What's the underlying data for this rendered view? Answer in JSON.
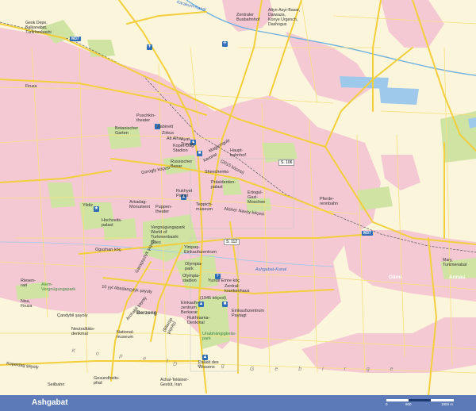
{
  "labels": {
    "karakum": "Karakum-Kanal",
    "bus": "Zentraler\nBusbahnhof",
    "altyn": "Altyn-Asyr-Basar,\nDarwaza,\nKonye Urgench,\nDashogus",
    "geok": "Geok Depe,\nBalkanabat,\nTurkmenbashi",
    "m37a": "M37",
    "m37b": "M37",
    "firuza": "Firuza",
    "puschkin": "Puschkin-\ntheater",
    "botan": "Botanischer\nGarten",
    "kabinet": "Kabinett",
    "zirkus": "Zirkus",
    "alta": "Alt Alha",
    "kopet": "Kopet-Dag-\nStadion",
    "ayat": "Ayat-\nTravel",
    "rbasar": "Russischer\nBasar",
    "hbahn": "Haupt-\nbahnhof",
    "s106": "S. 106",
    "gorogly": "Gorogly köçesi",
    "shevchenko": "Shevchenko",
    "magtymguly": "Magtymguly şayoly",
    "kemine": "Kemine",
    "atamyrat": "(2015 köçesi)",
    "pras": "Präsidenten-\npalast",
    "ertogrul": "Ertogul-\nGazi-\nMoschee",
    "rukhyet": "Rukhyet\nPalast",
    "atabaev": "Ataba",
    "yildiz": "Yildiz",
    "arkadag": "Arkadag-\nMonument",
    "puppen": "Puppen-\ntheater",
    "teppich": "Teppich-\nmuseum",
    "alisher": "Alisher Navoy köçesi",
    "hochzeit": "Hochzeits-\npalast",
    "pferde": "Pferde-\nrennbahn",
    "vergn": "Vergnügungspark\nWorld of\nTurkmenbashi\nTales",
    "s112": "S. 112",
    "yimpas": "Yimpaş-\nEinkaufszentrum",
    "oguzhan": "Oguzhan köç.",
    "garashsyzlyk": "Garaşsyzlyk şayoly",
    "olympia": "Olympia-\nstadion",
    "olympiac": "Olympia-\npark",
    "gunesh": "Güneşli",
    "ashgabatkanal": "Ashgabat-Kanal",
    "emre": "Yunus Emre köç",
    "zentral": "Zentral-\nkrankenhaus",
    "riesen": "Riesen-\nrad",
    "alem": "Alem-\nVergnügungspark",
    "yyl10": "10 yyl Abadançylyk şayoly",
    "ykoch": "(1945 köçesi)",
    "einkauf": "Einkaufs-\nzentrum\nBerkarar",
    "einkauf2": "Einkaufszentrum\nPaytagt",
    "nisa": "Nisa,\nFiruza",
    "berzeng": "Berzeng",
    "archab": "Archabil şayoly",
    "rukhnama": "Rukhnama-\nDenkmal",
    "bitarap": "(Bitarap\nşayoly)",
    "chandybil": "Çandybil şayoly",
    "neutral": "Neutralitäts-\ndenkmal",
    "natmus": "National-\nmuseum",
    "unab": "Unabhängigkeits-\npark",
    "kopetdag": "Kopetdag şayoly",
    "palast": "Palast des\nWissens",
    "kopetterrain": "K o p e t",
    "dag": "D a g",
    "gebirge": "G e b i r g e",
    "seilbahn": "Seilbahn",
    "gesund": "Gesundheits-\npfad",
    "achal": "Achal-Tekkiner-\nGestüt, Iran",
    "mary": "Mary,\nTurkmenabat",
    "gami": "Gämi",
    "annau": "Annau",
    "azadi": "Magtymguly"
  },
  "footer": {
    "title": "Ashgabat",
    "scale0": "0",
    "scale1": "900",
    "scale2": "1800 m"
  },
  "colors": {
    "background": "#fbf5dc",
    "urban": "#f4c9d4",
    "green": "#cfe3a3",
    "road": "#f2cf3b",
    "water": "#9ec9ea",
    "footer": "#5c7ab8",
    "icon": "#2f6db5"
  }
}
